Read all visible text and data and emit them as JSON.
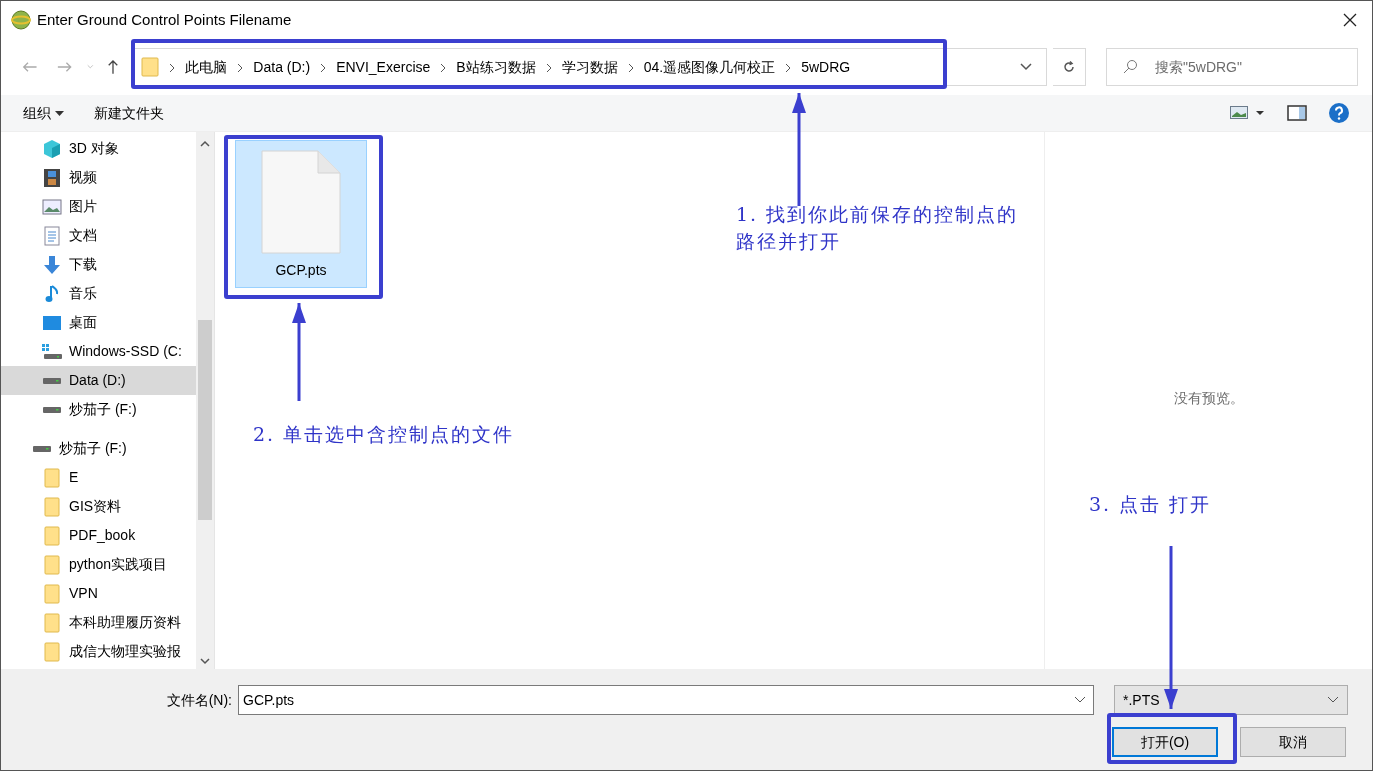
{
  "window": {
    "title": "Enter Ground Control Points Filename"
  },
  "breadcrumb": [
    "此电脑",
    "Data (D:)",
    "ENVI_Exercise",
    "B站练习数据",
    "学习数据",
    "04.遥感图像几何校正",
    "5wDRG"
  ],
  "search": {
    "placeholder": "搜索\"5wDRG\""
  },
  "toolbar": {
    "organize": "组织",
    "new_folder": "新建文件夹"
  },
  "sidebar": {
    "groups": [
      {
        "items": [
          {
            "label": "3D 对象",
            "kind": "cube",
            "selected": false
          },
          {
            "label": "视频",
            "kind": "film",
            "selected": false
          },
          {
            "label": "图片",
            "kind": "image",
            "selected": false
          },
          {
            "label": "文档",
            "kind": "doc",
            "selected": false
          },
          {
            "label": "下载",
            "kind": "download",
            "selected": false
          },
          {
            "label": "音乐",
            "kind": "music",
            "selected": false
          },
          {
            "label": "桌面",
            "kind": "desktop",
            "selected": false
          },
          {
            "label": "Windows-SSD (C:",
            "kind": "windrive",
            "selected": false
          },
          {
            "label": "Data (D:)",
            "kind": "drive",
            "selected": true
          },
          {
            "label": "炒茄子 (F:)",
            "kind": "drive",
            "selected": false
          }
        ]
      },
      {
        "label": "炒茄子 (F:)",
        "kind": "drive",
        "selected": false,
        "items": [
          {
            "label": "E",
            "kind": "folder",
            "selected": false
          },
          {
            "label": "GIS资料",
            "kind": "folder",
            "selected": false
          },
          {
            "label": "PDF_book",
            "kind": "folder",
            "selected": false
          },
          {
            "label": "python实践项目",
            "kind": "folder",
            "selected": false
          },
          {
            "label": "VPN",
            "kind": "folder",
            "selected": false
          },
          {
            "label": "本科助理履历资料",
            "kind": "folder",
            "selected": false
          },
          {
            "label": "成信大物理实验报",
            "kind": "folder",
            "selected": false
          }
        ]
      }
    ]
  },
  "files": [
    {
      "name": "GCP.pts",
      "selected": true
    }
  ],
  "preview": {
    "text": "没有预览。"
  },
  "filename": {
    "label": "文件名(N):",
    "value": "GCP.pts"
  },
  "filter": {
    "value": "*.PTS"
  },
  "buttons": [
    {
      "label": "打开(O)",
      "kind": "primary"
    },
    {
      "label": "取消",
      "kind": "cancel"
    }
  ],
  "annotations": [
    {
      "text": "1. 找到你此前保存的控制点的路径并打开"
    },
    {
      "text": "2. 单击选中含控制点的文件"
    },
    {
      "text": "3. 点击 打开"
    }
  ]
}
